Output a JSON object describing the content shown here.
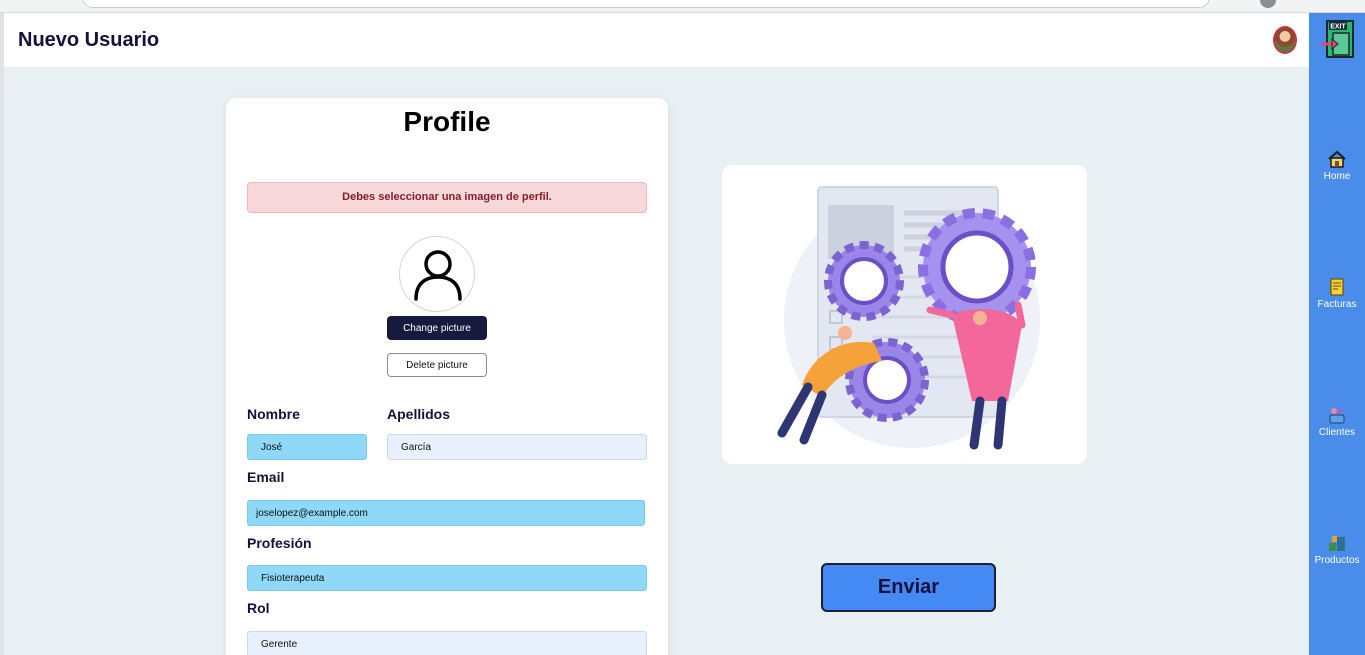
{
  "header": {
    "title": "Nuevo Usuario"
  },
  "sidebar": {
    "exit_text": "EXIT",
    "items": [
      {
        "label": "Home",
        "icon": "house-icon"
      },
      {
        "label": "Facturas",
        "icon": "invoice-icon"
      },
      {
        "label": "Clientes",
        "icon": "clients-icon"
      },
      {
        "label": "Productos",
        "icon": "products-icon"
      }
    ]
  },
  "profile": {
    "heading": "Profile",
    "alert": "Debes seleccionar una imagen de perfil.",
    "change_picture": "Change picture",
    "delete_picture": "Delete picture",
    "fields": {
      "nombre": {
        "label": "Nombre",
        "value": "José"
      },
      "apellidos": {
        "label": "Apellidos",
        "value": "García"
      },
      "email": {
        "label": "Email",
        "value": "joselopez@example.com"
      },
      "profesion": {
        "label": "Profesión",
        "value": "Fisioterapeuta"
      },
      "rol": {
        "label": "Rol",
        "value": "Gerente"
      }
    }
  },
  "actions": {
    "submit": "Enviar"
  },
  "colors": {
    "sidebar": "#4a8ce9",
    "primary_button": "#4589f5",
    "alert_bg": "#f8d7da",
    "highlight_field": "#8fd8f8"
  }
}
